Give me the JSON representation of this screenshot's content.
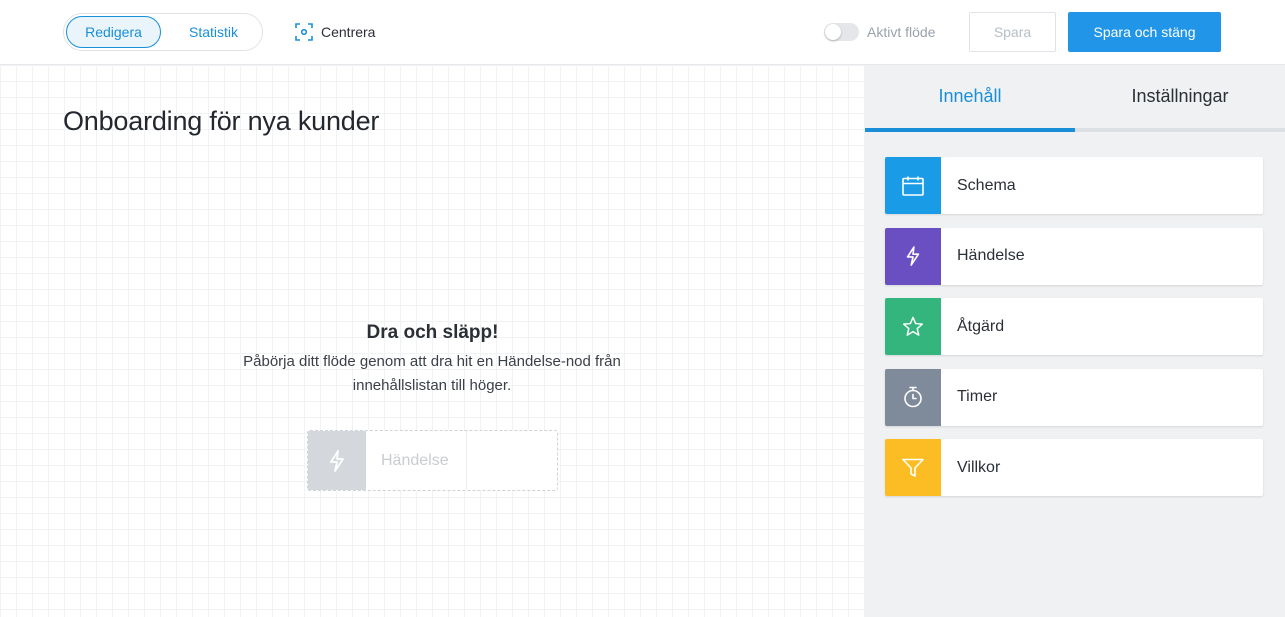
{
  "topbar": {
    "mode_tabs": {
      "edit": "Redigera",
      "stats": "Statistik"
    },
    "center_label": "Centrera",
    "active_flow_label": "Aktivt flöde",
    "active_flow_on": false,
    "save_label": "Spara",
    "save_close_label": "Spara och stäng"
  },
  "canvas": {
    "flow_title": "Onboarding för nya kunder",
    "empty_title": "Dra och släpp!",
    "empty_desc": "Påbörja ditt flöde genom att dra hit en Händelse-nod från innehållslistan till höger.",
    "ghost_node_label": "Händelse"
  },
  "panel": {
    "tabs": [
      {
        "label": "Innehåll",
        "active": true
      },
      {
        "label": "Inställningar",
        "active": false
      }
    ],
    "items": [
      {
        "label": "Schema",
        "icon": "calendar-icon",
        "color": "#1a9be6"
      },
      {
        "label": "Händelse",
        "icon": "lightning-icon",
        "color": "#6a4fc3"
      },
      {
        "label": "Åtgärd",
        "icon": "star-icon",
        "color": "#34b57d"
      },
      {
        "label": "Timer",
        "icon": "stopwatch-icon",
        "color": "#7f8a9b"
      },
      {
        "label": "Villkor",
        "icon": "filter-icon",
        "color": "#fbbd23"
      }
    ]
  },
  "colors": {
    "accent": "#1a8fd8",
    "primary_button": "#2196e8"
  }
}
